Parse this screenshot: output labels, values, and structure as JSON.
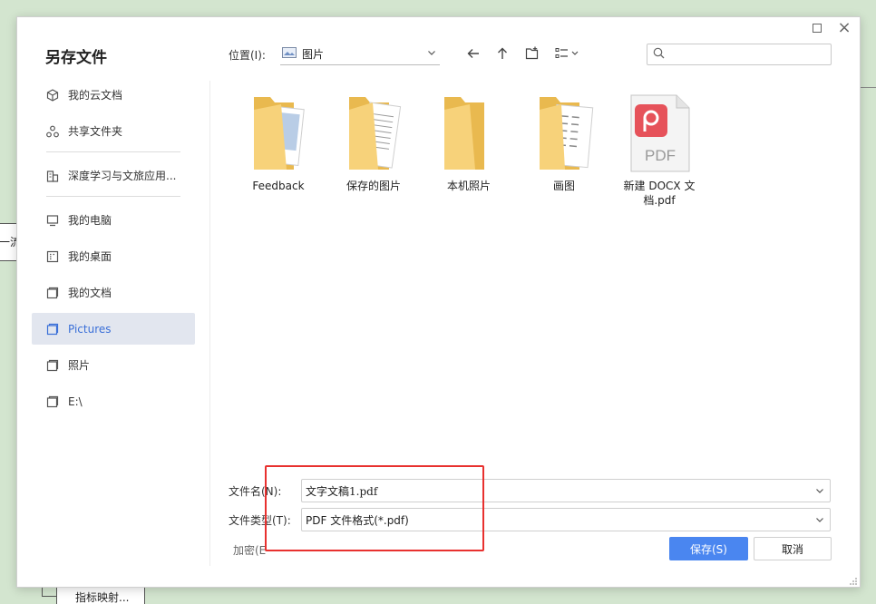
{
  "background": {
    "node_left_text": "一流",
    "node_bottom_text": "指标映射..."
  },
  "dialog": {
    "title": "另存文件",
    "window_controls": {
      "maximize": "maximize-icon",
      "close": "×"
    }
  },
  "sidebar": {
    "items": [
      {
        "label": "我的云文档",
        "icon": "cloud-cube-icon"
      },
      {
        "label": "共享文件夹",
        "icon": "share-icon"
      },
      {
        "label": "深度学习与文旅应用...",
        "icon": "team-icon"
      },
      {
        "label": "我的电脑",
        "icon": "computer-icon"
      },
      {
        "label": "我的桌面",
        "icon": "desktop-icon"
      },
      {
        "label": "我的文档",
        "icon": "folder-outline-icon"
      },
      {
        "label": "Pictures",
        "icon": "folder-outline-icon",
        "active": true
      },
      {
        "label": "照片",
        "icon": "folder-outline-icon"
      },
      {
        "label": "E:\\",
        "icon": "folder-outline-icon"
      }
    ]
  },
  "toolbar": {
    "location_label": "位置(I):",
    "location_value": "图片",
    "search_placeholder": ""
  },
  "files": [
    {
      "name": "Feedback",
      "type": "folder-docs"
    },
    {
      "name": "保存的图片",
      "type": "folder-docs"
    },
    {
      "name": "本机照片",
      "type": "folder-empty"
    },
    {
      "name": "画图",
      "type": "folder-docs"
    },
    {
      "name": "新建 DOCX 文档.pdf",
      "type": "pdf"
    }
  ],
  "pdf_icon_text": "PDF",
  "form": {
    "filename_label": "文件名(N):",
    "filename_value": "文字文稿1.pdf",
    "filetype_label": "文件类型(T):",
    "filetype_value": "PDF 文件格式(*.pdf)",
    "encrypt_label": "加密(E",
    "save_label": "保存(S)",
    "cancel_label": "取消"
  },
  "colors": {
    "accent": "#4a86f0",
    "annotation": "#e8312f",
    "pdf_badge": "#e6525a",
    "folder": "#f7d27a"
  }
}
